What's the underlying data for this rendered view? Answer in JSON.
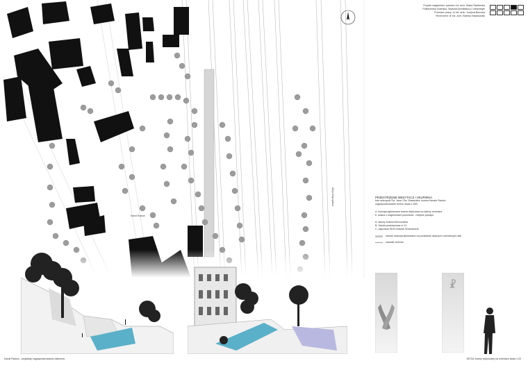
{
  "header": {
    "lines": [
      "Projekt magisterski, autorka: inż. arch. Marta Świderska",
      "Politechnika Gdańska, Wydział Architektury i Urbanistyki",
      "Promotor pracy: dr inż. arch. Justyna Borucka",
      "Recenzent: dr inż. arch. Bartosz Macikowski"
    ]
  },
  "title_boxes": {
    "count": 10,
    "filled_index": 3
  },
  "compass": {
    "icon": "north-arrow-icon",
    "label": "N"
  },
  "legend": {
    "heading_lines": [
      "PRZESTRZENIE MEDYTACJI I SKUPIENIA",
      "tuła nekropolii Św. Jana i Św. Zbawiciela, bulwar Kanału Raduni",
      "zagospodarowanie terenu skala 1:500"
    ],
    "numbered": [
      "a. nowozprojektowana brama wejściowa na dawny cmentarz",
      "b. ściana z fragmentami pomników - miejsce pamięci"
    ],
    "lettered": [
      "A. dawny kościół Mennonitów",
      "B. Szkoła podstawowa nr 21",
      "C. zajezdnia SKM Gdańsk Śródmieście"
    ],
    "items": [
      {
        "label": "ścieżki nowozprojektowane na podstawie dawnych cmentarnych alei",
        "color": "#c8c8c8"
      },
      {
        "label": "zasadzi ułożone",
        "color": "#9a9a9a"
      }
    ]
  },
  "map_labels": {
    "street1": "Kanał Raduni",
    "street2": "Aleja Zwycięstwa"
  },
  "captions": {
    "left": "Kanał Raduni - przykłady zagospodarowania nabrzeża",
    "right": "DETAL bramy wejściowej na cmentarz skala 1:20"
  },
  "gate": {
    "symbol": "☧"
  }
}
